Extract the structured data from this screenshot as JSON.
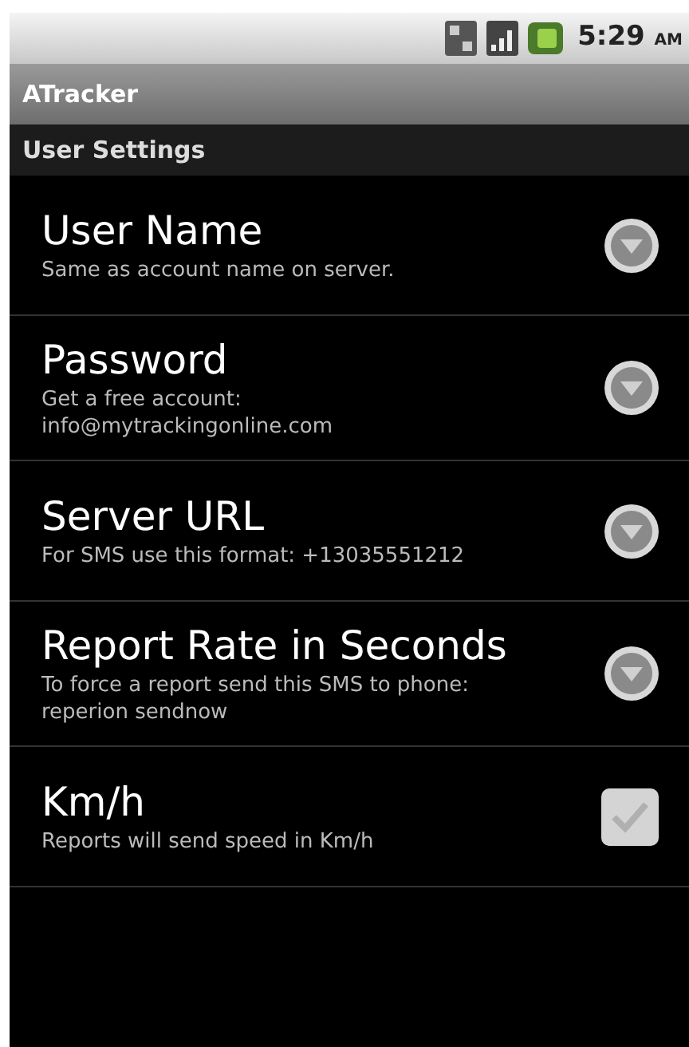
{
  "status_bar": {
    "time": "5:29",
    "ampm": "AM"
  },
  "app_title": "ATracker",
  "section_header": "User Settings",
  "settings": [
    {
      "kind": "dialog",
      "title": "User Name",
      "summary": "Same as account name on server."
    },
    {
      "kind": "dialog",
      "title": "Password",
      "summary": "Get a free account: info@mytrackingonline.com"
    },
    {
      "kind": "dialog",
      "title": "Server URL",
      "summary": "For SMS use this format: +13035551212"
    },
    {
      "kind": "dialog",
      "title": "Report Rate in Seconds",
      "summary": "To force a report send this SMS to phone: reperion sendnow"
    },
    {
      "kind": "checkbox",
      "title": "Km/h",
      "summary": "Reports will send speed in Km/h",
      "checked": true
    }
  ]
}
